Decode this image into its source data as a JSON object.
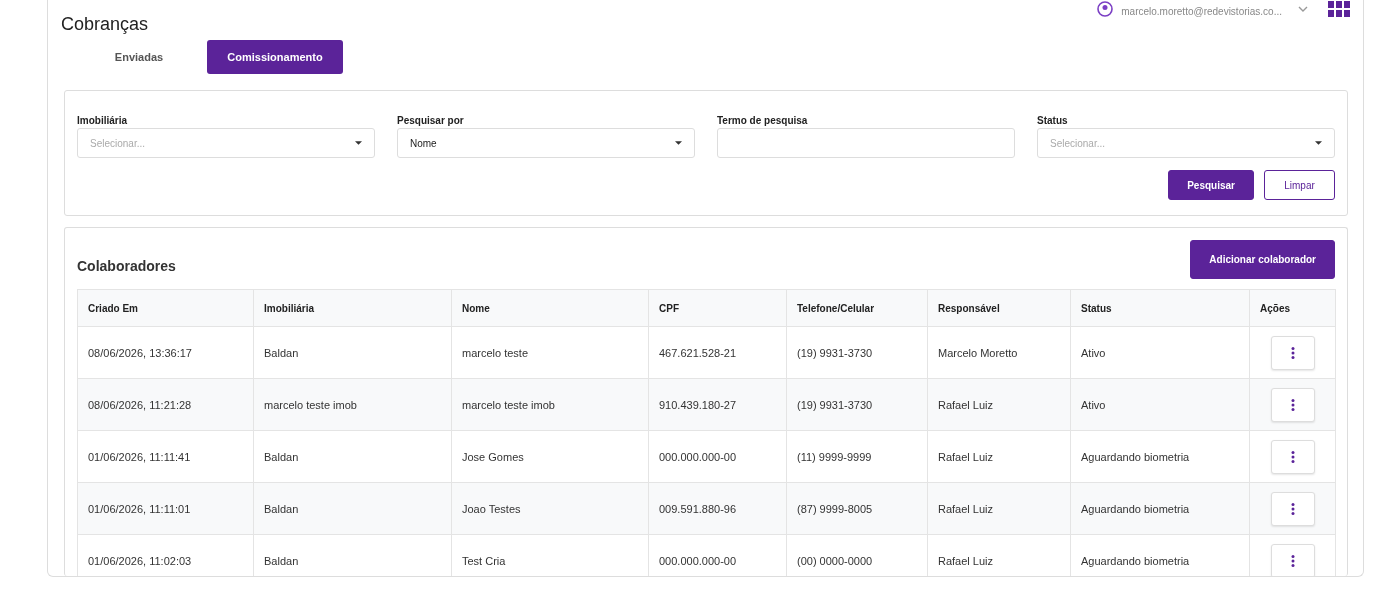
{
  "page": {
    "title": "Cobranças"
  },
  "user": {
    "email": "marcelo.moretto@redevistorias.co..."
  },
  "tabs": [
    {
      "label": "Enviadas",
      "selected": false
    },
    {
      "label": "Comissionamento",
      "selected": true
    }
  ],
  "filters": {
    "fields": [
      {
        "kind": "select",
        "label": "Imobiliária",
        "placeholder": "Selecionar..."
      },
      {
        "kind": "select",
        "label": "Pesquisar por",
        "value": "Nome"
      },
      {
        "kind": "text",
        "label": "Termo de pesquisa"
      },
      {
        "kind": "select",
        "label": "Status",
        "placeholder": "Selecionar..."
      }
    ],
    "buttons": [
      {
        "kind": "primary",
        "label": "Pesquisar"
      },
      {
        "kind": "outline",
        "label": "Limpar"
      }
    ]
  },
  "table": {
    "title": "Colaboradores",
    "add_button": "Adicionar colaborador",
    "columns": [
      "Criado Em",
      "Imobiliária",
      "Nome",
      "CPF",
      "Telefone/Celular",
      "Responsável",
      "Status",
      "Ações"
    ],
    "rows": [
      [
        "08/06/2026, 13:36:17",
        "Baldan",
        "marcelo teste",
        "467.621.528-21",
        "(19) 9931-3730",
        "Marcelo Moretto",
        "Ativo"
      ],
      [
        "08/06/2026, 11:21:28",
        "marcelo teste imob",
        "marcelo teste imob",
        "910.439.180-27",
        "(19) 9931-3730",
        "Rafael Luiz",
        "Ativo"
      ],
      [
        "01/06/2026, 11:11:41",
        "Baldan",
        "Jose Gomes",
        "000.000.000-00",
        "(11) 9999-9999",
        "Rafael Luiz",
        "Aguardando biometria"
      ],
      [
        "01/06/2026, 11:11:01",
        "Baldan",
        "Joao Testes",
        "009.591.880-96",
        "(87) 9999-8005",
        "Rafael Luiz",
        "Aguardando biometria"
      ],
      [
        "01/06/2026, 11:02:03",
        "Baldan",
        "Test Cria",
        "000.000.000-00",
        "(00) 0000-0000",
        "Rafael Luiz",
        "Aguardando biometria"
      ]
    ]
  }
}
